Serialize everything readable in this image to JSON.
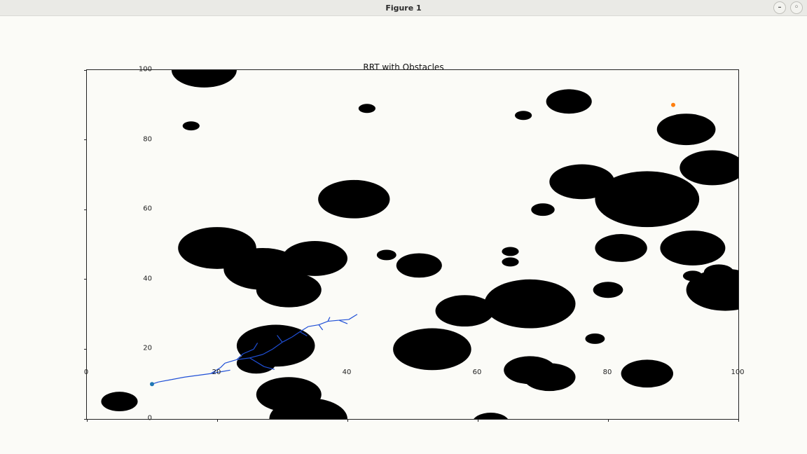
{
  "window": {
    "title": "Figure 1",
    "minimize_label": "–",
    "maximize_label": "◦"
  },
  "chart_data": {
    "type": "scatter",
    "title": "RRT with Obstacles",
    "xlim": [
      0,
      100
    ],
    "ylim": [
      0,
      100
    ],
    "xticks": [
      0,
      20,
      40,
      60,
      80,
      100
    ],
    "yticks": [
      0,
      20,
      40,
      60,
      80,
      100
    ],
    "start": {
      "x": 10,
      "y": 10,
      "color": "#1f77b4"
    },
    "goal": {
      "x": 90,
      "y": 90,
      "color": "#ff7f0e"
    },
    "obstacles": [
      {
        "x": 18,
        "y": 100,
        "r": 5
      },
      {
        "x": 16,
        "y": 84,
        "r": 1.3
      },
      {
        "x": 43,
        "y": 89,
        "r": 1.3
      },
      {
        "x": 67,
        "y": 87,
        "r": 1.3
      },
      {
        "x": 74,
        "y": 91,
        "r": 3.5
      },
      {
        "x": 92,
        "y": 83,
        "r": 4.5
      },
      {
        "x": 96,
        "y": 72,
        "r": 5
      },
      {
        "x": 76,
        "y": 68,
        "r": 5
      },
      {
        "x": 86,
        "y": 63,
        "r": 8
      },
      {
        "x": 82,
        "y": 49,
        "r": 4
      },
      {
        "x": 93,
        "y": 49,
        "r": 5
      },
      {
        "x": 98,
        "y": 37,
        "r": 6
      },
      {
        "x": 97,
        "y": 42,
        "r": 2.3
      },
      {
        "x": 93,
        "y": 41,
        "r": 1.5
      },
      {
        "x": 86,
        "y": 13,
        "r": 4
      },
      {
        "x": 78,
        "y": 23,
        "r": 1.5
      },
      {
        "x": 80,
        "y": 37,
        "r": 2.3
      },
      {
        "x": 68,
        "y": 33,
        "r": 7
      },
      {
        "x": 65,
        "y": 48,
        "r": 1.3
      },
      {
        "x": 65,
        "y": 45,
        "r": 1.3
      },
      {
        "x": 70,
        "y": 60,
        "r": 1.8
      },
      {
        "x": 71,
        "y": 12,
        "r": 4
      },
      {
        "x": 68,
        "y": 14,
        "r": 4
      },
      {
        "x": 62,
        "y": -1,
        "r": 2.8
      },
      {
        "x": 58,
        "y": 31,
        "r": 4.5
      },
      {
        "x": 51,
        "y": 44,
        "r": 3.5
      },
      {
        "x": 53,
        "y": 20,
        "r": 6
      },
      {
        "x": 46,
        "y": 47,
        "r": 1.5
      },
      {
        "x": 41,
        "y": 63,
        "r": 5.5
      },
      {
        "x": 34,
        "y": 0,
        "r": 6
      },
      {
        "x": 31,
        "y": 7,
        "r": 5
      },
      {
        "x": 29,
        "y": 21,
        "r": 6
      },
      {
        "x": 26,
        "y": 16,
        "r": 3
      },
      {
        "x": 27,
        "y": 43,
        "r": 6
      },
      {
        "x": 31,
        "y": 37,
        "r": 5
      },
      {
        "x": 35,
        "y": 46,
        "r": 5
      },
      {
        "x": 20,
        "y": 49,
        "r": 6
      },
      {
        "x": 5,
        "y": 5,
        "r": 2.8
      }
    ],
    "tree_edges": [
      [
        [
          10,
          10
        ],
        [
          11,
          10.6
        ]
      ],
      [
        [
          11,
          10.6
        ],
        [
          13,
          11.3
        ]
      ],
      [
        [
          13,
          11.3
        ],
        [
          15,
          12
        ]
      ],
      [
        [
          15,
          12
        ],
        [
          17,
          12.5
        ]
      ],
      [
        [
          17,
          12.5
        ],
        [
          19,
          13
        ]
      ],
      [
        [
          19,
          13
        ],
        [
          20.5,
          13.5
        ]
      ],
      [
        [
          20.5,
          13.5
        ],
        [
          22,
          14
        ]
      ],
      [
        [
          19,
          13
        ],
        [
          20.5,
          14.7
        ]
      ],
      [
        [
          20.5,
          14.7
        ],
        [
          21.2,
          16
        ]
      ],
      [
        [
          21.2,
          16
        ],
        [
          23,
          17
        ]
      ],
      [
        [
          23,
          17
        ],
        [
          25,
          17.5
        ]
      ],
      [
        [
          25,
          17.5
        ],
        [
          27.2,
          15
        ]
      ],
      [
        [
          27.2,
          15
        ],
        [
          28.8,
          14.2
        ]
      ],
      [
        [
          25,
          17.5
        ],
        [
          27,
          18.5
        ]
      ],
      [
        [
          27,
          18.5
        ],
        [
          28.5,
          20
        ]
      ],
      [
        [
          28.5,
          20
        ],
        [
          30,
          22
        ]
      ],
      [
        [
          30,
          22
        ],
        [
          31.5,
          23.5
        ]
      ],
      [
        [
          31.5,
          23.5
        ],
        [
          32.7,
          25
        ]
      ],
      [
        [
          32.7,
          25
        ],
        [
          34,
          26.5
        ]
      ],
      [
        [
          34,
          26.5
        ],
        [
          35.6,
          27
        ]
      ],
      [
        [
          35.6,
          27
        ],
        [
          37,
          28
        ]
      ],
      [
        [
          37,
          28
        ],
        [
          37.3,
          29.2
        ]
      ],
      [
        [
          37,
          28
        ],
        [
          38.7,
          28.3
        ]
      ],
      [
        [
          38.7,
          28.3
        ],
        [
          40.2,
          28.5
        ]
      ],
      [
        [
          40.2,
          28.5
        ],
        [
          41.5,
          30
        ]
      ],
      [
        [
          23,
          17
        ],
        [
          24,
          18.7
        ]
      ],
      [
        [
          24,
          18.7
        ],
        [
          25.6,
          20
        ]
      ],
      [
        [
          25.6,
          20
        ],
        [
          26.2,
          21.8
        ]
      ],
      [
        [
          30,
          22
        ],
        [
          29.2,
          24
        ]
      ],
      [
        [
          32.7,
          25
        ],
        [
          33.8,
          23.8
        ]
      ],
      [
        [
          35.6,
          27
        ],
        [
          36.2,
          25.5
        ]
      ],
      [
        [
          38.7,
          28.3
        ],
        [
          40,
          27.3
        ]
      ]
    ]
  }
}
